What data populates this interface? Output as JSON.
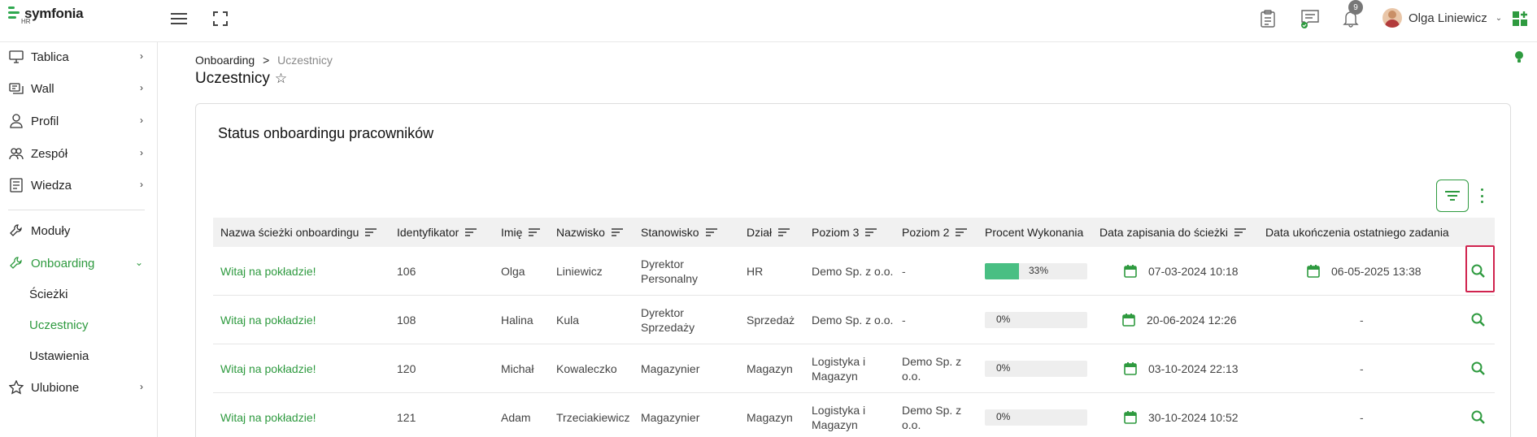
{
  "brand": {
    "name": "symfonia",
    "sub": "HR",
    "color": "#2fa84f"
  },
  "header": {
    "icons": [
      "menu-icon",
      "fullscreen-icon",
      "clipboard-icon",
      "chat-icon",
      "bell-icon",
      "apps-icon"
    ],
    "notifications_count": "9",
    "user_name": "Olga Liniewicz"
  },
  "sidebar": {
    "items": [
      {
        "label": "Tablica",
        "icon": "monitor-icon"
      },
      {
        "label": "Wall",
        "icon": "wall-icon"
      },
      {
        "label": "Profil",
        "icon": "profile-icon"
      },
      {
        "label": "Zespół",
        "icon": "team-icon"
      },
      {
        "label": "Wiedza",
        "icon": "knowledge-icon"
      },
      {
        "label": "Moduły",
        "icon": "wrench-icon"
      },
      {
        "label": "Onboarding",
        "icon": "wrench-icon"
      },
      {
        "label": "Ulubione",
        "icon": "star-icon"
      }
    ],
    "sub_items": [
      "Ścieżki",
      "Uczestnicy",
      "Ustawienia"
    ]
  },
  "breadcrumb": {
    "parent": "Onboarding",
    "separator": ">",
    "current": "Uczestnicy"
  },
  "page_title": "Uczestnicy",
  "card": {
    "title": "Status onboardingu pracowników"
  },
  "table": {
    "columns": [
      "Nazwa ścieżki onboardingu",
      "Identyfikator",
      "Imię",
      "Nazwisko",
      "Stanowisko",
      "Dział",
      "Poziom 3",
      "Poziom 2",
      "Procent Wykonania",
      "Data zapisania do ścieżki",
      "Data ukończenia ostatniego zadania"
    ],
    "rows": [
      {
        "path": "Witaj na pokładzie!",
        "id": "106",
        "first": "Olga",
        "last": "Liniewicz",
        "position": "Dyrektor Personalny",
        "dept": "HR",
        "level3": "Demo Sp. z o.o.",
        "level2": "-",
        "percent": 33,
        "percent_label": "33%",
        "enrolled": "07-03-2024 10:18",
        "completed": "06-05-2025 13:38"
      },
      {
        "path": "Witaj na pokładzie!",
        "id": "108",
        "first": "Halina",
        "last": "Kula",
        "position": "Dyrektor Sprzedaży",
        "dept": "Sprzedaż",
        "level3": "Demo Sp. z o.o.",
        "level2": "-",
        "percent": 0,
        "percent_label": "0%",
        "enrolled": "20-06-2024 12:26",
        "completed": "-"
      },
      {
        "path": "Witaj na pokładzie!",
        "id": "120",
        "first": "Michał",
        "last": "Kowaleczko",
        "position": "Magazynier",
        "dept": "Magazyn",
        "level3": "Logistyka i Magazyn",
        "level2": "Demo Sp. z o.o.",
        "percent": 0,
        "percent_label": "0%",
        "enrolled": "03-10-2024 22:13",
        "completed": "-"
      },
      {
        "path": "Witaj na pokładzie!",
        "id": "121",
        "first": "Adam",
        "last": "Trzeciakiewicz",
        "position": "Magazynier",
        "dept": "Magazyn",
        "level3": "Logistyka i Magazyn",
        "level2": "Demo Sp. z o.o.",
        "percent": 0,
        "percent_label": "0%",
        "enrolled": "30-10-2024 10:52",
        "completed": "-"
      }
    ]
  },
  "colors": {
    "accent": "#2e9a3f",
    "progress_fill": "#49bf83",
    "highlight": "#d0234e"
  }
}
